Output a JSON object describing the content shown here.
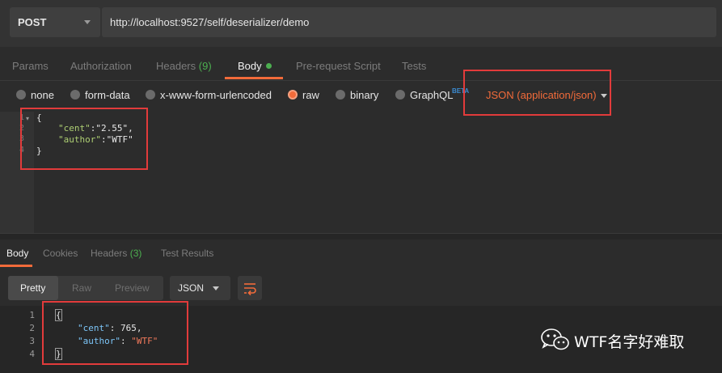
{
  "request": {
    "method": "POST",
    "url": "http://localhost:9527/self/deserializer/demo"
  },
  "request_tabs": {
    "params": "Params",
    "authorization": "Authorization",
    "headers_label": "Headers",
    "headers_count": "(9)",
    "body": "Body",
    "prerequest": "Pre-request Script",
    "tests": "Tests"
  },
  "body_types": {
    "none": "none",
    "form_data": "form-data",
    "urlencoded": "x-www-form-urlencoded",
    "raw": "raw",
    "binary": "binary",
    "graphql": "GraphQL",
    "beta": "BETA",
    "selected": "raw",
    "content_type": "JSON (application/json)"
  },
  "request_body": {
    "line_numbers": [
      "1",
      "2",
      "3",
      "4"
    ],
    "open_brace": "{",
    "cent_key": "\"cent\"",
    "cent_sep": ":",
    "cent_value": "\"2.55\"",
    "comma": ",",
    "author_key": "\"author\"",
    "author_sep": ":",
    "author_value": "\"WTF\"",
    "close_brace": "}"
  },
  "response_tabs": {
    "body": "Body",
    "cookies": "Cookies",
    "headers_label": "Headers",
    "headers_count": "(3)",
    "test_results": "Test Results"
  },
  "response_toolbar": {
    "pretty": "Pretty",
    "raw": "Raw",
    "preview": "Preview",
    "format": "JSON"
  },
  "response_body": {
    "line_numbers": [
      "1",
      "2",
      "3",
      "4"
    ],
    "open_brace": "{",
    "cent_key": "\"cent\"",
    "cent_sep": ": ",
    "cent_value": "765",
    "comma": ",",
    "author_key": "\"author\"",
    "author_sep": ": ",
    "author_value": "\"WTF\"",
    "close_brace": "}"
  },
  "watermark": {
    "text": "WTF名字好难取"
  },
  "colors": {
    "accent": "#f26b3a",
    "highlight_box": "#e23b3b",
    "count_green": "#4caf50"
  }
}
